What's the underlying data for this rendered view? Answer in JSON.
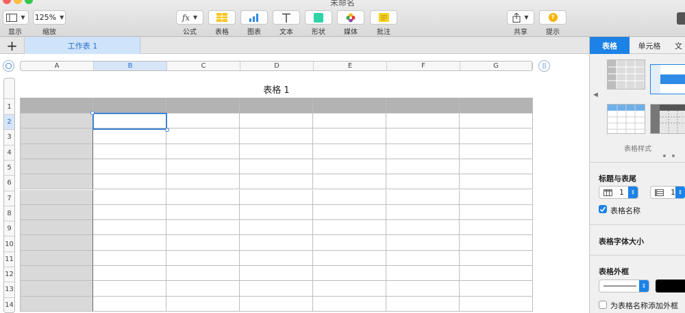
{
  "window": {
    "title": "未命名"
  },
  "toolbar": {
    "view_label": "显示",
    "zoom_value": "125%",
    "zoom_label": "缩放",
    "formula_label": "公式",
    "table_label": "表格",
    "chart_label": "图表",
    "text_label": "文本",
    "shape_label": "形状",
    "media_label": "媒体",
    "comment_label": "批注",
    "share_label": "共享",
    "tips_label": "提示",
    "formula_icon_text": "fx",
    "tips_icon_text": "?"
  },
  "sheets": {
    "tabs": [
      {
        "label": "工作表 1",
        "active": true
      }
    ]
  },
  "table": {
    "title": "表格 1",
    "columns": [
      "A",
      "B",
      "C",
      "D",
      "E",
      "F",
      "G"
    ],
    "rows": [
      "1",
      "2",
      "3",
      "4",
      "5",
      "6",
      "7",
      "8",
      "9",
      "10",
      "11",
      "12",
      "13",
      "14"
    ],
    "selected_column": "B",
    "selected_row": "2",
    "freeze_icon_text": "||"
  },
  "inspector": {
    "tabs": [
      "表格",
      "单元格",
      "文"
    ],
    "active_tab": "表格",
    "styles_label": "表格样式",
    "header_footer_title": "标题与表尾",
    "header_rows_value": "1",
    "header_cols_value": "1",
    "table_name_checkbox_label": "表格名称",
    "table_name_checked": true,
    "font_size_title": "表格字体大小",
    "border_title": "表格外框",
    "name_border_checkbox_label": "为表格名称添加外框",
    "name_border_checked": false
  },
  "colors": {
    "accent": "#1c82e6",
    "header_row": "#b3b3b3",
    "header_col": "#d9d9d9",
    "selection": "#3b82d6",
    "sheet_tab": "#cfe3fa"
  }
}
